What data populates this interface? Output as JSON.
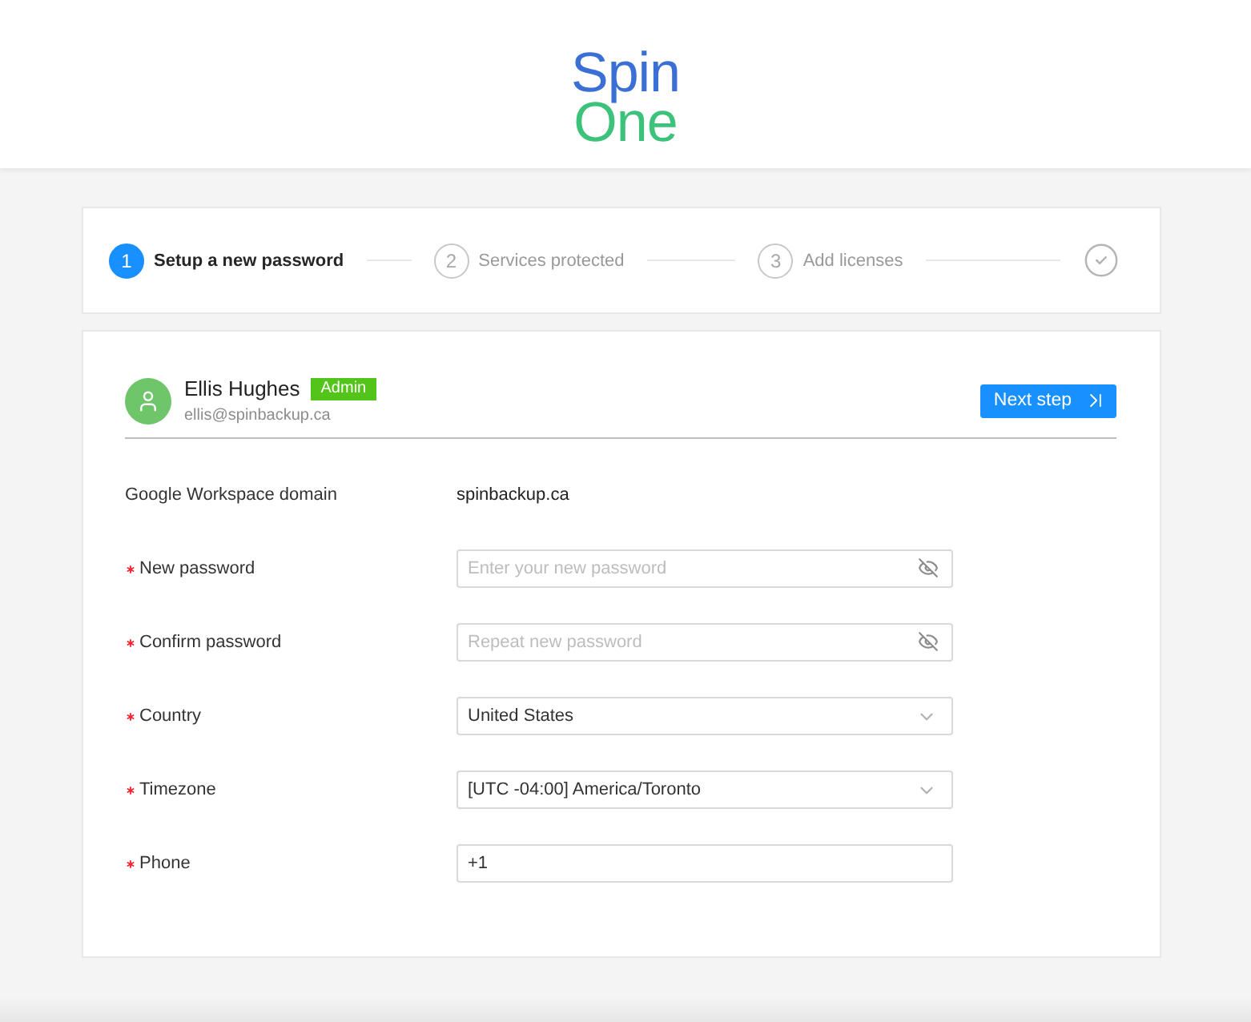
{
  "logo": {
    "line1": "Spin",
    "line2": "One"
  },
  "steps": [
    {
      "number": "1",
      "label": "Setup a new password",
      "selected": true
    },
    {
      "number": "2",
      "label": "Services protected",
      "selected": false
    },
    {
      "number": "3",
      "label": "Add licenses",
      "selected": false
    }
  ],
  "user": {
    "name": "Ellis Hughes",
    "badge": "Admin",
    "email": "ellis@spinbackup.ca"
  },
  "next_button": {
    "label": "Next step"
  },
  "fields": [
    {
      "kind": "text",
      "label": "Google Workspace domain",
      "value": "spinbackup.ca"
    },
    {
      "kind": "password",
      "label": "New password",
      "required": true,
      "placeholder": "Enter your new password"
    },
    {
      "kind": "password",
      "label": "Confirm password",
      "required": true,
      "placeholder": "Repeat new password"
    },
    {
      "kind": "select",
      "label": "Country",
      "required": true,
      "value": "United States"
    },
    {
      "kind": "select",
      "label": "Timezone",
      "required": true,
      "value": "[UTC -04:00] America/Toronto"
    },
    {
      "kind": "input",
      "label": "Phone",
      "required": true,
      "value": "+1"
    }
  ]
}
